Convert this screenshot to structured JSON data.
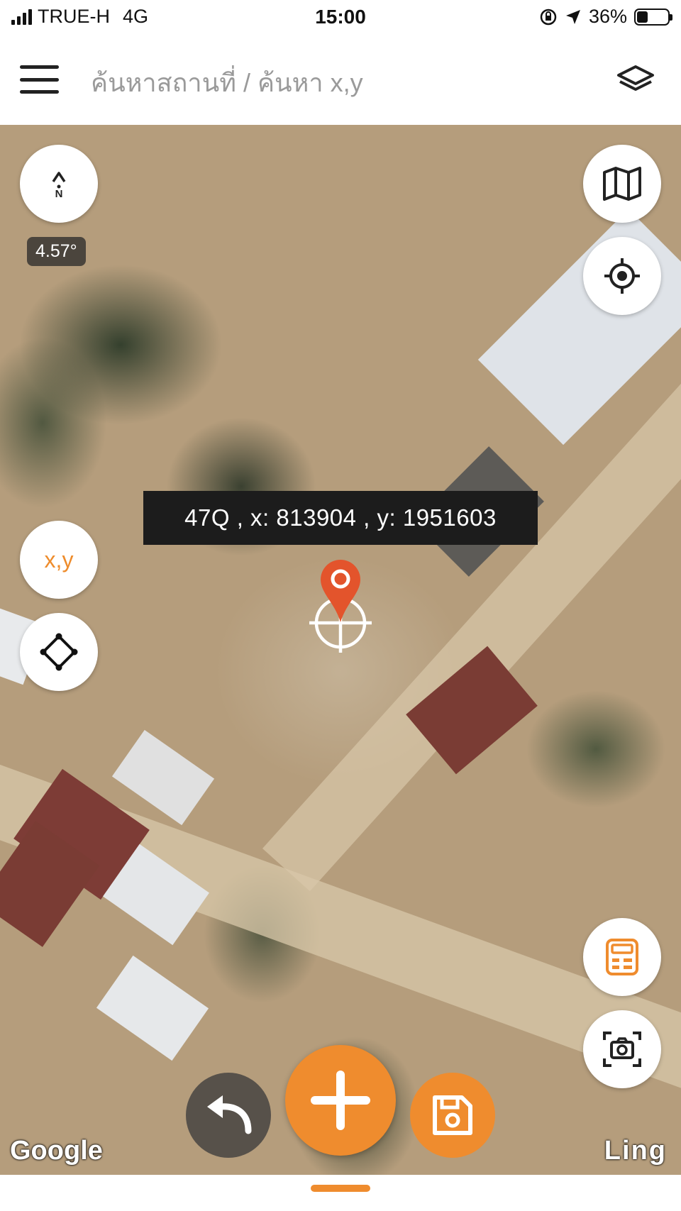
{
  "status_bar": {
    "carrier": "TRUE-H",
    "network": "4G",
    "time": "15:00",
    "battery": "36%",
    "battery_level": 0.36
  },
  "header": {
    "breadcrumb": "ค้นหาสถานที่ / ค้นหา x,y"
  },
  "icons": {
    "menu": "menu-icon",
    "layers": "layers-icon",
    "compass": "compass-icon",
    "basemap": "map-icon",
    "locate": "crosshair-icon",
    "polygon": "polygon-icon",
    "calculator": "calculator-icon",
    "screenshot": "camera-icon",
    "undo": "undo-icon",
    "add": "plus-icon",
    "save": "save-icon",
    "marker": "location-pin-icon"
  },
  "map": {
    "compass": {
      "north_label": "N",
      "rotation": "4.57°"
    },
    "xy_button_label": "x,y",
    "coordinate": "47Q , x: 813904 , y: 1951603",
    "attribution_left": "Google",
    "attribution_right": "Ling"
  },
  "colors": {
    "accent": "#ef8c2e",
    "dark": "#1c1c1c",
    "muted_text": "#9a9a9a"
  }
}
